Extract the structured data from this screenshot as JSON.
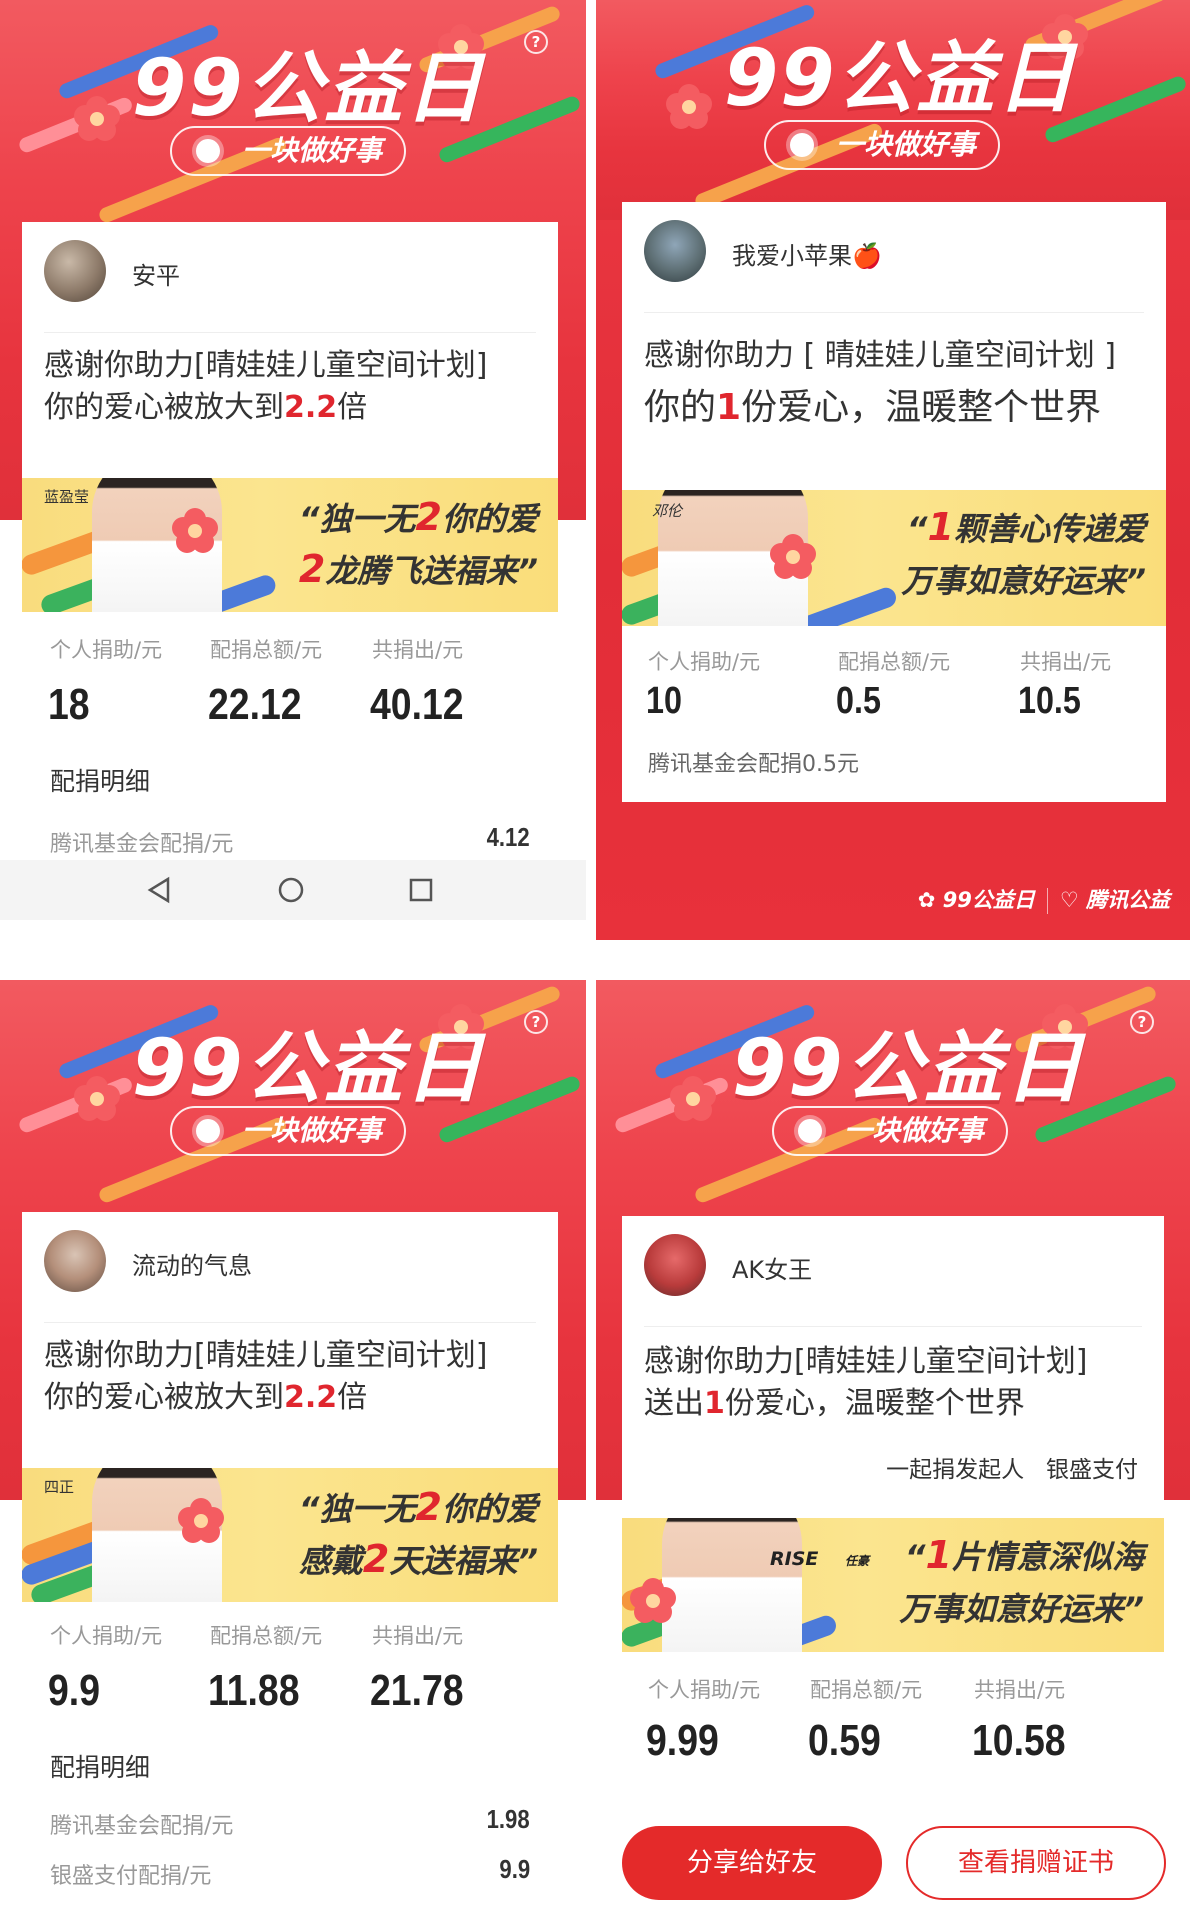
{
  "common": {
    "event_title": "99公益日",
    "slogan": "一块做好事",
    "help_symbol": "?"
  },
  "colors": {
    "brand_red": "#e42a2a",
    "highlight_red": "#e0262e",
    "banner_yellow": "#fbe58f"
  },
  "icons": [
    "help-icon",
    "flower-icon",
    "back-icon",
    "home-icon",
    "recents-icon",
    "heart-logo-icon"
  ],
  "panel1": {
    "user": "安平",
    "thanks_line1": "感谢你助力[晴娃娃儿童空间计划]",
    "thanks_line2_prefix": "你的爱心被放大到",
    "thanks_line2_value": "2.2",
    "thanks_line2_suffix": "倍",
    "celebrity": "蓝盈莹",
    "quote_line1_a": "“独一无",
    "quote_line1_hl": "2",
    "quote_line1_b": "你的爱",
    "quote_line2_hl": "2",
    "quote_line2_b": "龙腾飞送福来”",
    "stats": {
      "personal_label": "个人捐助/元",
      "personal_value": "18",
      "match_label": "配捐总额/元",
      "match_value": "22.12",
      "total_label": "共捐出/元",
      "total_value": "40.12"
    },
    "detail_head": "配捐明细",
    "details": [
      {
        "label": "腾讯基金会配捐/元",
        "value": "4.12"
      }
    ]
  },
  "panel2": {
    "user": "我爱小苹果🍎",
    "thanks_line1": "感谢你助力 [ 晴娃娃儿童空间计划 ]",
    "thanks_line2_prefix": "你的",
    "thanks_line2_value": "1",
    "thanks_line2_suffix": "份爱心，温暖整个世界",
    "celebrity": "邓伦",
    "quote_line1_a": "“",
    "quote_line1_hl": "1",
    "quote_line1_b": "颗善心传递爱",
    "quote_line2": "万事如意好运来”",
    "stats": {
      "personal_label": "个人捐助/元",
      "personal_value": "10",
      "match_label": "配捐总额/元",
      "match_value": "0.5",
      "total_label": "共捐出/元",
      "total_value": "10.5"
    },
    "note": "腾讯基金会配捐0.5元",
    "footer_left": "99公益日",
    "footer_right": "腾讯公益"
  },
  "panel3": {
    "user": "流动的气息",
    "thanks_line1": "感谢你助力[晴娃娃儿童空间计划]",
    "thanks_line2_prefix": "你的爱心被放大到",
    "thanks_line2_value": "2.2",
    "thanks_line2_suffix": "倍",
    "celebrity": "四正",
    "quote_line1_a": "“独一无",
    "quote_line1_hl": "2",
    "quote_line1_b": "你的爱",
    "quote_line2_a": "感戴",
    "quote_line2_hl": "2",
    "quote_line2_b": "天送福来”",
    "stats": {
      "personal_label": "个人捐助/元",
      "personal_value": "9.9",
      "match_label": "配捐总额/元",
      "match_value": "11.88",
      "total_label": "共捐出/元",
      "total_value": "21.78"
    },
    "detail_head": "配捐明细",
    "details": [
      {
        "label": "腾讯基金会配捐/元",
        "value": "1.98"
      },
      {
        "label": "银盛支付配捐/元",
        "value": "9.9"
      }
    ]
  },
  "panel4": {
    "user": "AK女王",
    "thanks_line1": "感谢你助力[晴娃娃儿童空间计划]",
    "thanks_line2_prefix": "送出",
    "thanks_line2_value": "1",
    "thanks_line2_suffix": "份爱心，温暖整个世界",
    "initiator_label": "一起捐发起人",
    "initiator_name": "银盛支付",
    "badge": "RISE",
    "celebrity": "任豪",
    "quote_line1_a": "“",
    "quote_line1_hl": "1",
    "quote_line1_b": "片情意深似海",
    "quote_line2": "万事如意好运来”",
    "stats": {
      "personal_label": "个人捐助/元",
      "personal_value": "9.99",
      "match_label": "配捐总额/元",
      "match_value": "0.59",
      "total_label": "共捐出/元",
      "total_value": "10.58"
    },
    "share_button": "分享给好友",
    "certificate_button": "查看捐赠证书"
  }
}
